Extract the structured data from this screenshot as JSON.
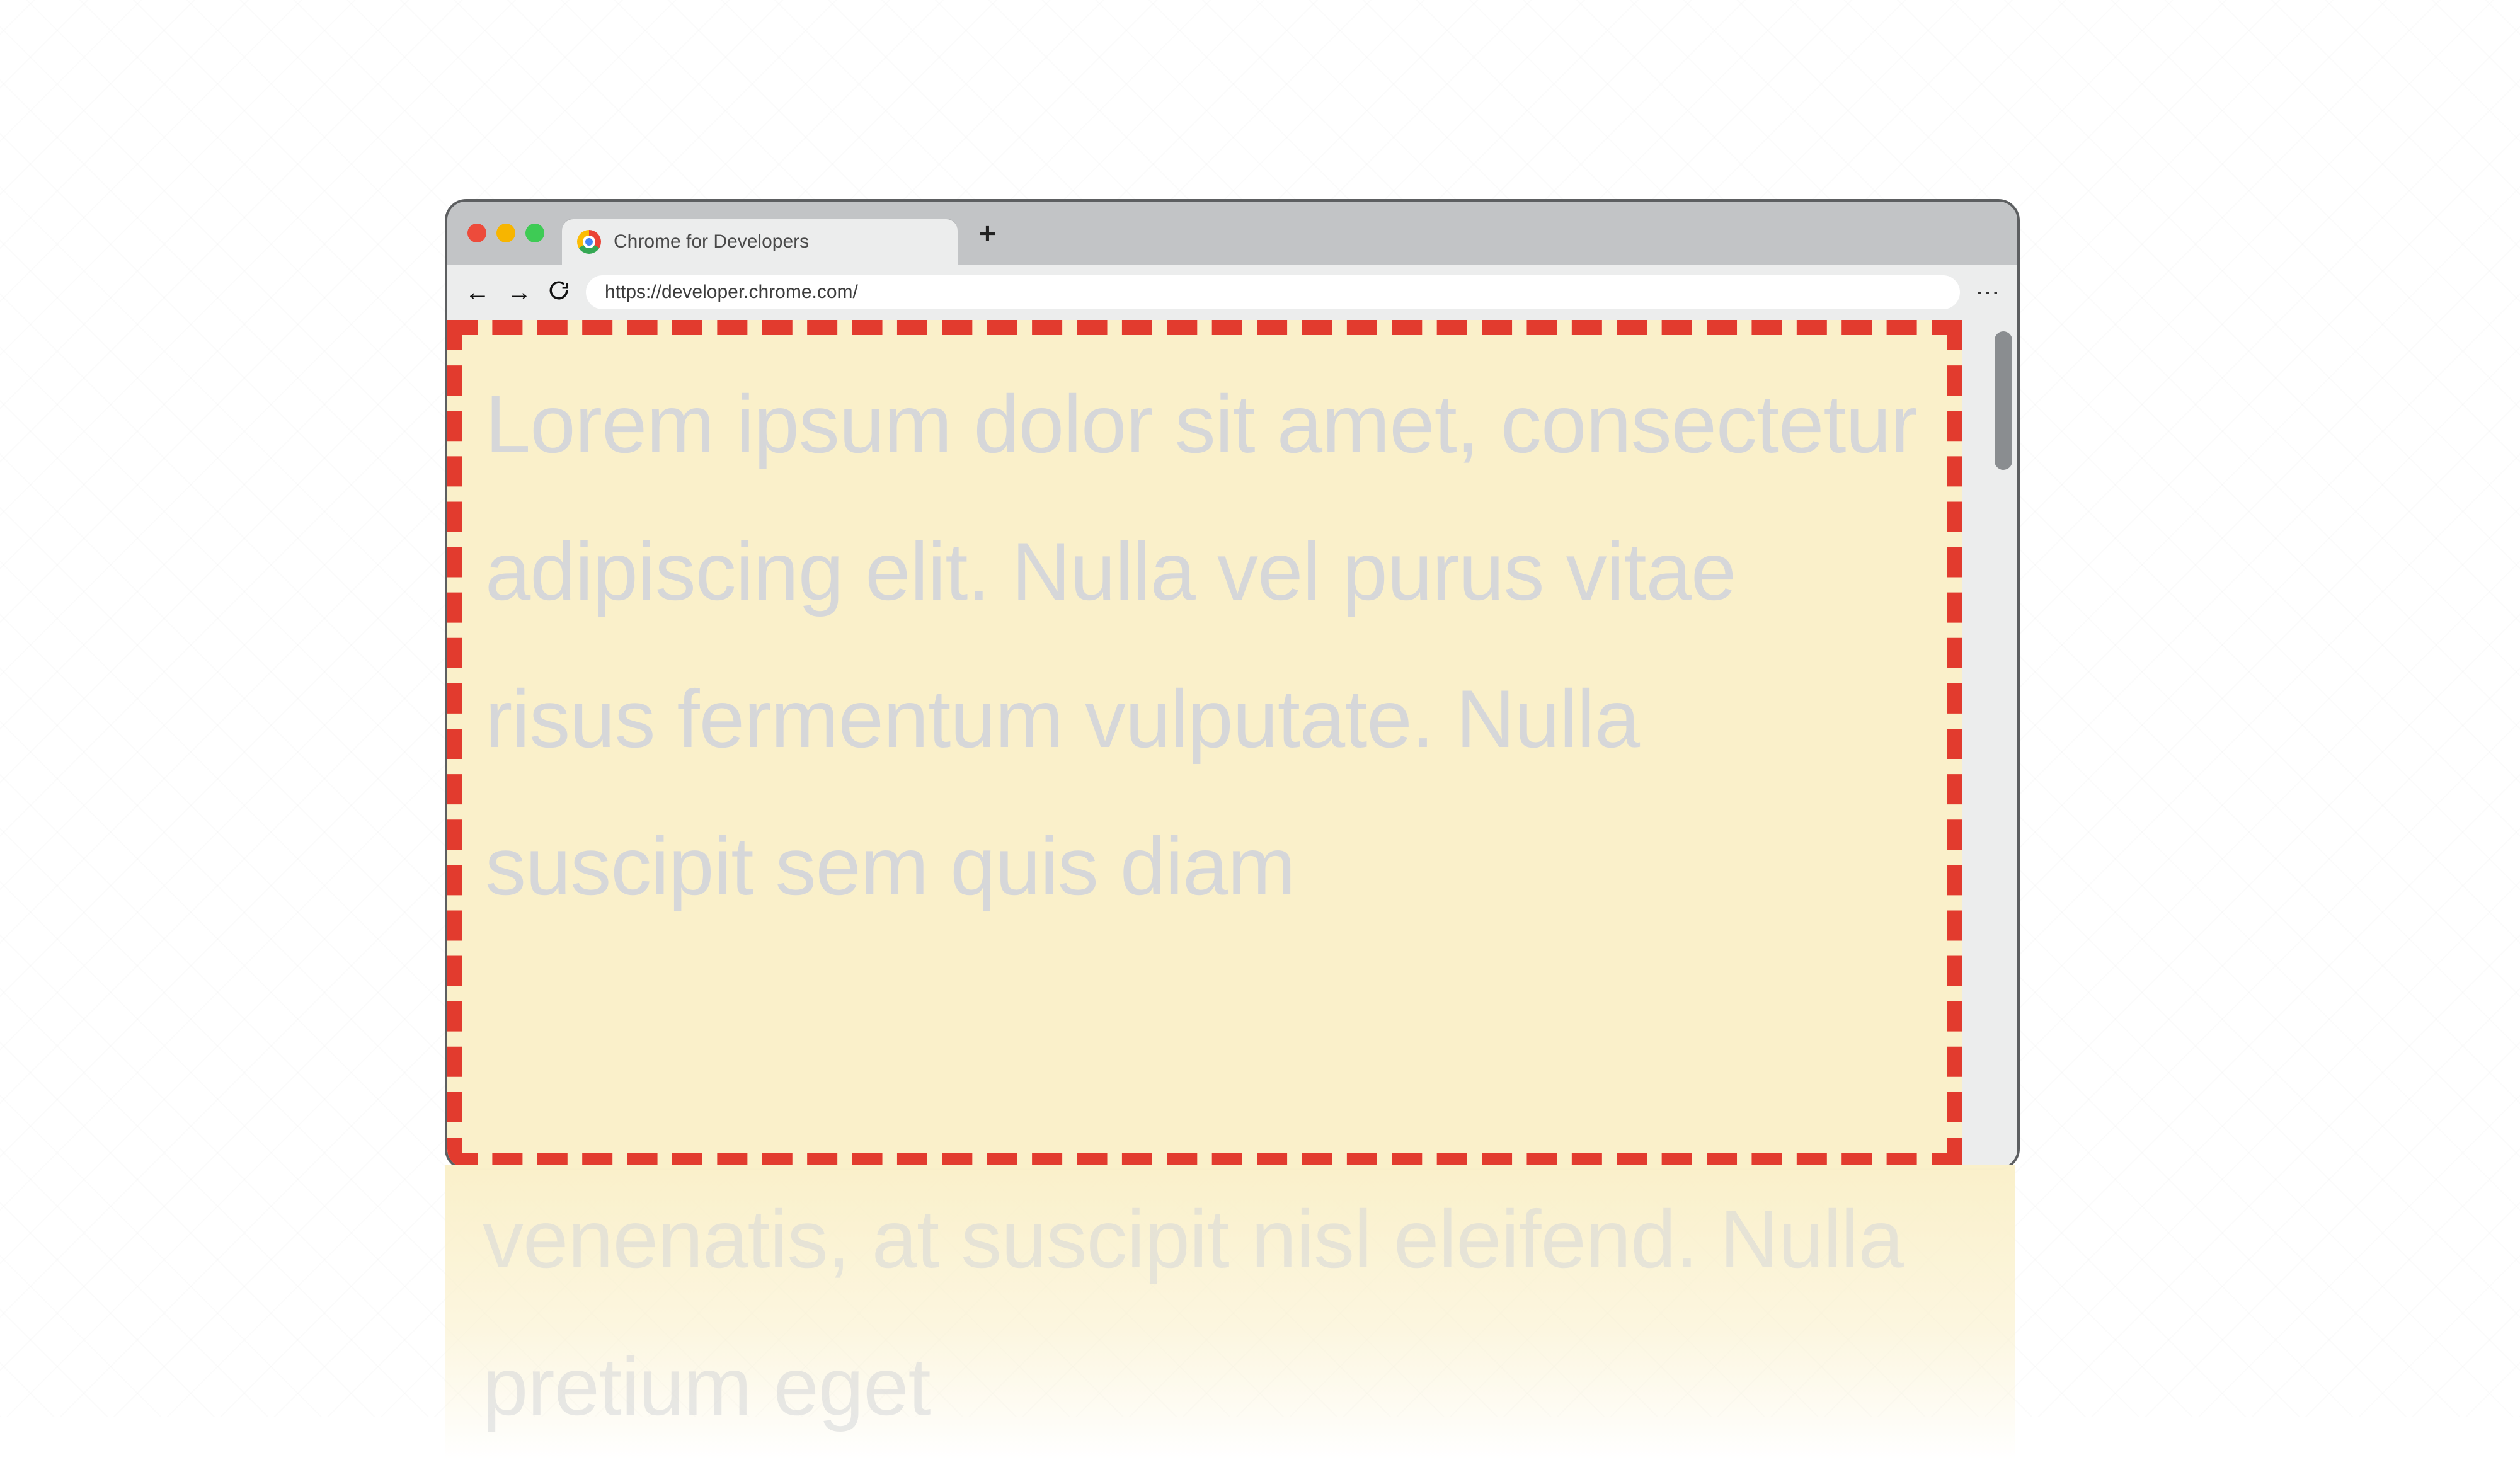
{
  "tab": {
    "title": "Chrome for Developers"
  },
  "toolbar": {
    "back_icon": "←",
    "forward_icon": "→",
    "new_tab_icon": "+",
    "menu_icon": "⋮",
    "url": "https://developer.chrome.com/"
  },
  "content": {
    "visible_text": "Lorem ipsum dolor sit amet, consectetur adipiscing elit. Nulla vel purus vitae risus fermentum vulputate. Nulla suscipit sem quis diam",
    "overflow_text": "venenatis, at suscipit nisl eleifend. Nulla pretium eget"
  },
  "colors": {
    "highlight_border": "#e23b2e",
    "page_bg": "#faf0ca",
    "text_gray": "#d6d7d9"
  }
}
